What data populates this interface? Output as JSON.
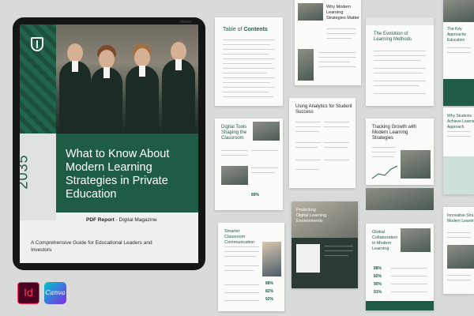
{
  "cover": {
    "year": "2035",
    "title": "What to Know About Modern Learning Strategies in Private Education",
    "subtitle_bold": "PDF Report",
    "subtitle_rest": " - Digital Magazine",
    "guide": "A Comprehensive Guide for Educational Leaders and Investors"
  },
  "apps": {
    "indesign": "Id",
    "canva": "Canva"
  },
  "pages": {
    "toc_title_light": "Table of ",
    "toc_title_bold": "Contents",
    "why_title": "Why Modern Learning Strategies Matter",
    "evolution_title": "The Evolution of Learning Methods",
    "key_title": "The Key Approache Education",
    "analytics_title": "Using Analytics for Student Success",
    "digital_tools_title": "Digital Tools Shaping the Classroom",
    "digital_stat": "89%",
    "tracking_title": "Tracking Growth with Modern Learning Strategies",
    "why_achieve_title": "Why Students Achieve Learning Approach",
    "protecting_title": "Protecting Digital Learning Environments",
    "global_title": "Global Collaboration in Modern Learning",
    "smarter_title": "Smarter Classroom Communication",
    "innovative_title": "Innovative Stra Modern Learning",
    "smarter_stats": [
      "88%",
      "82%",
      "92%"
    ],
    "global_stats": [
      "88%",
      "82%",
      "90%",
      "91%"
    ]
  },
  "colors": {
    "brand_green": "#1f5c46",
    "background": "#d9dbda",
    "tablet": "#141615"
  }
}
